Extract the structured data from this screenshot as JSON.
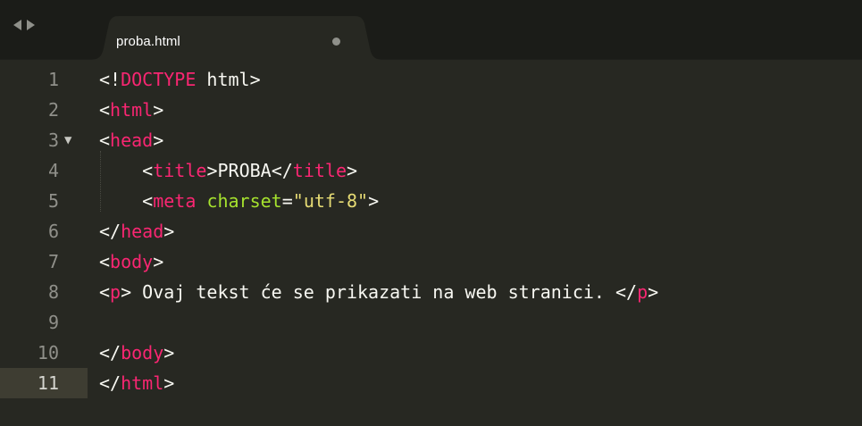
{
  "tabs": [
    {
      "label": "proba.html",
      "dirty": true
    }
  ],
  "colors": {
    "background": "#272822",
    "tabbar": "#1b1c18",
    "tab_active": "#272822",
    "tag": "#f92672",
    "attribute": "#a6e22e",
    "string": "#e6db74",
    "text": "#f8f8f2",
    "gutter": "#90908a"
  },
  "icons": {
    "back": "caret-left",
    "forward": "caret-right",
    "fold": "▼",
    "dirty": "dot"
  },
  "editor": {
    "current_line": 11,
    "lines": [
      {
        "num": "1",
        "fold": "",
        "tokens": [
          [
            "p",
            "<!"
          ],
          [
            "t",
            "DOCTYPE"
          ],
          [
            "x",
            " html"
          ],
          [
            "p",
            ">"
          ]
        ]
      },
      {
        "num": "2",
        "fold": "",
        "tokens": [
          [
            "p",
            "<"
          ],
          [
            "t",
            "html"
          ],
          [
            "p",
            ">"
          ]
        ]
      },
      {
        "num": "3",
        "fold": "▼",
        "tokens": [
          [
            "p",
            "<"
          ],
          [
            "t",
            "head"
          ],
          [
            "p",
            ">"
          ]
        ]
      },
      {
        "num": "4",
        "fold": "",
        "tokens": [
          [
            "x",
            "    "
          ],
          [
            "p",
            "<"
          ],
          [
            "t",
            "title"
          ],
          [
            "p",
            ">"
          ],
          [
            "x",
            "PROBA"
          ],
          [
            "p",
            "</"
          ],
          [
            "t",
            "title"
          ],
          [
            "p",
            ">"
          ]
        ]
      },
      {
        "num": "5",
        "fold": "",
        "tokens": [
          [
            "x",
            "    "
          ],
          [
            "p",
            "<"
          ],
          [
            "t",
            "meta"
          ],
          [
            "x",
            " "
          ],
          [
            "a",
            "charset"
          ],
          [
            "p",
            "="
          ],
          [
            "s",
            "\"utf-8\""
          ],
          [
            "p",
            ">"
          ]
        ]
      },
      {
        "num": "6",
        "fold": "",
        "tokens": [
          [
            "p",
            "</"
          ],
          [
            "t",
            "head"
          ],
          [
            "p",
            ">"
          ]
        ]
      },
      {
        "num": "7",
        "fold": "",
        "tokens": [
          [
            "p",
            "<"
          ],
          [
            "t",
            "body"
          ],
          [
            "p",
            ">"
          ]
        ]
      },
      {
        "num": "8",
        "fold": "",
        "tokens": [
          [
            "p",
            "<"
          ],
          [
            "t",
            "p"
          ],
          [
            "p",
            ">"
          ],
          [
            "x",
            " Ovaj tekst će se prikazati na web stranici. "
          ],
          [
            "p",
            "</"
          ],
          [
            "t",
            "p"
          ],
          [
            "p",
            ">"
          ]
        ]
      },
      {
        "num": "9",
        "fold": "",
        "tokens": []
      },
      {
        "num": "10",
        "fold": "",
        "tokens": [
          [
            "p",
            "</"
          ],
          [
            "t",
            "body"
          ],
          [
            "p",
            ">"
          ]
        ]
      },
      {
        "num": "11",
        "fold": "",
        "tokens": [
          [
            "p",
            "</"
          ],
          [
            "t",
            "html"
          ],
          [
            "p",
            ">"
          ]
        ]
      }
    ]
  }
}
